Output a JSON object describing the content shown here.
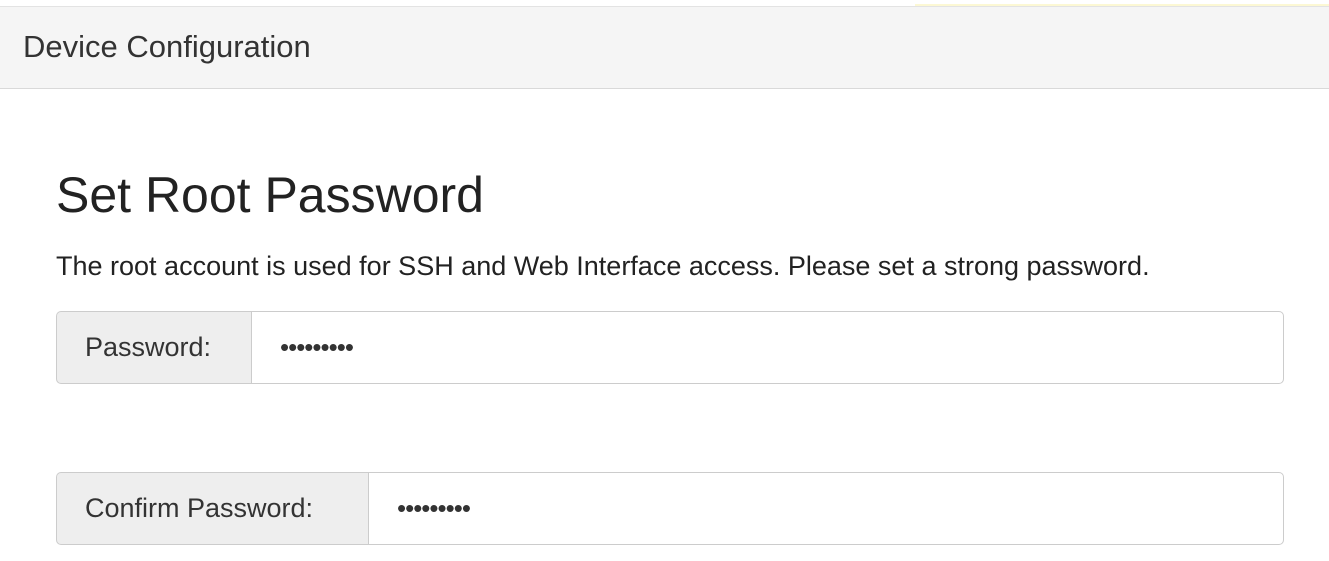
{
  "navbar": {
    "brand": "Device Configuration"
  },
  "main": {
    "title": "Set Root Password",
    "description": "The root account is used for SSH and Web Interface access. Please set a strong password.",
    "password": {
      "label": "Password:",
      "value": "•••••••••"
    },
    "confirm_password": {
      "label": "Confirm Password:",
      "value": "•••••••••"
    }
  }
}
